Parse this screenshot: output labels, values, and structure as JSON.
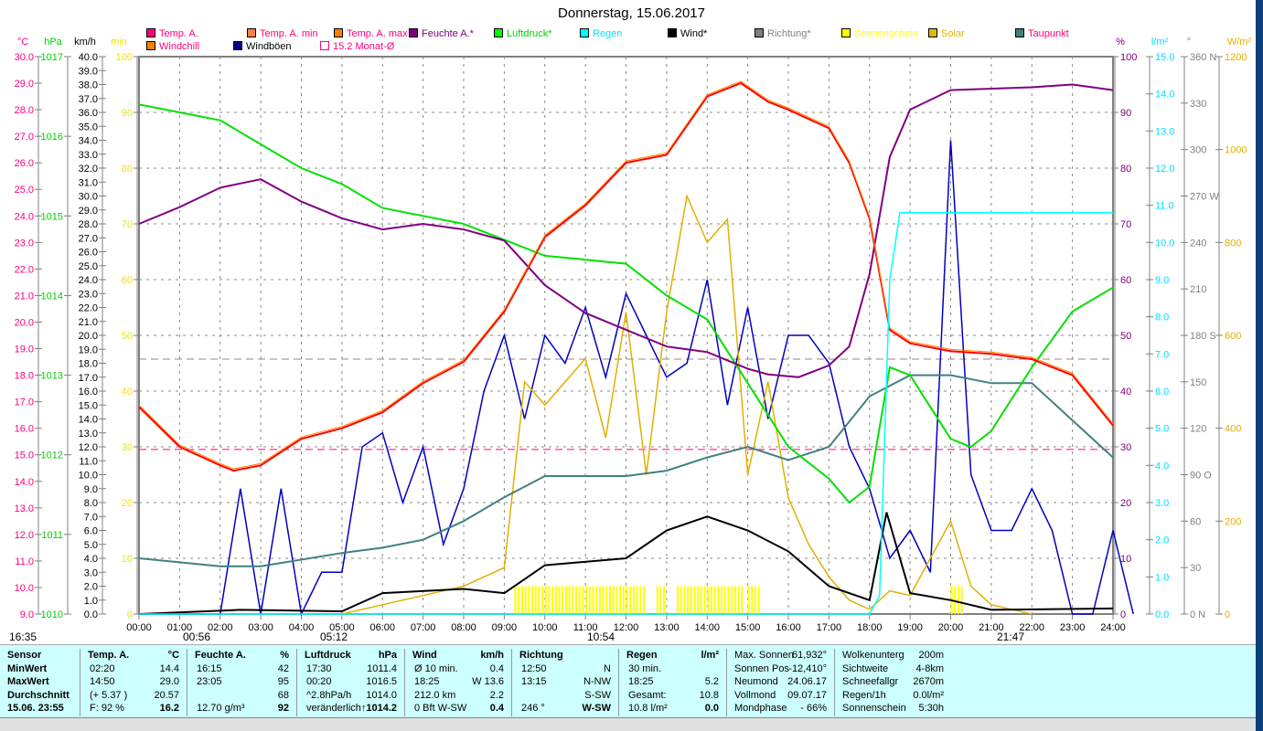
{
  "title": "Donnerstag, 15.06.2017",
  "legend": [
    {
      "label": "Temp. A.",
      "color": "#ff0080",
      "text": "#ff0080"
    },
    {
      "label": "Temp. A. min",
      "color": "#ff8040",
      "text": "#ff0080"
    },
    {
      "label": "Temp. A. max",
      "color": "#ff8000",
      "text": "#ff0080"
    },
    {
      "label": "Feuchte A.*",
      "color": "#800080",
      "text": "#800080"
    },
    {
      "label": "Luftdruck*",
      "color": "#00ff00",
      "text": "#00d000"
    },
    {
      "label": "Regen",
      "color": "#00ffff",
      "text": "#00e0ff"
    },
    {
      "label": "Wind*",
      "color": "#000000",
      "text": "#000000"
    },
    {
      "label": "Richtung*",
      "color": "#808080",
      "text": "#808080"
    },
    {
      "label": "Sonnenschein",
      "color": "#ffff00",
      "text": "#ffff00"
    },
    {
      "label": "Solar",
      "color": "#e0b800",
      "text": "#e0b800"
    },
    {
      "label": "Taupunkt",
      "color": "#408080",
      "text": "#ff0080"
    },
    {
      "label": "Windchill",
      "color": "#ff8000",
      "text": "#ff0080"
    },
    {
      "label": "Windböen",
      "color": "#000090",
      "text": "#000000"
    },
    {
      "label": "15.2 Monat-Ø",
      "color": "#ff0080",
      "text": "#ff0080"
    }
  ],
  "units": {
    "temp": "°C",
    "press": "hPa",
    "wind": "km/h",
    "sun": "min",
    "hum": "%",
    "rain": "l/m²",
    "dir": "°",
    "solar": "W/m²"
  },
  "sun_markers": {
    "moonset": "16:35",
    "moonrise": "00:56",
    "sunrise": "05:12",
    "noon": "10:54",
    "sunset": "21:47"
  },
  "chart_data": {
    "type": "line",
    "title": "Donnerstag, 15.06.2017",
    "x_range_hours": [
      0,
      24
    ],
    "x_ticks": [
      "00:00",
      "01:00",
      "02:00",
      "03:00",
      "04:00",
      "05:00",
      "06:00",
      "07:00",
      "08:00",
      "09:00",
      "10:00",
      "11:00",
      "12:00",
      "13:00",
      "14:00",
      "15:00",
      "16:00",
      "17:00",
      "18:00",
      "19:00",
      "20:00",
      "21:00",
      "22:00",
      "23:00",
      "24:00"
    ],
    "axes": {
      "temp": [
        9,
        30
      ],
      "press": [
        1010,
        1017
      ],
      "wind": [
        0,
        40
      ],
      "sun": [
        0,
        100
      ],
      "hum": [
        0,
        100
      ],
      "rain": [
        0,
        15
      ],
      "dir": [
        0,
        360
      ],
      "solar": [
        0,
        1200
      ]
    },
    "dir_labels": {
      "0": "N",
      "90": "O",
      "180": "S",
      "270": "W",
      "360": "N"
    },
    "month_avg_temp": 15.2,
    "series": [
      {
        "name": "Temp. A.",
        "axis": "temp",
        "color": "#ff0000",
        "points": [
          [
            0,
            16.8
          ],
          [
            1,
            15.3
          ],
          [
            2,
            14.6
          ],
          [
            2.33,
            14.4
          ],
          [
            3,
            14.6
          ],
          [
            4,
            15.6
          ],
          [
            5,
            16
          ],
          [
            6,
            16.6
          ],
          [
            7,
            17.7
          ],
          [
            8,
            18.5
          ],
          [
            9,
            20.4
          ],
          [
            10,
            23.2
          ],
          [
            11,
            24.4
          ],
          [
            12,
            26
          ],
          [
            13,
            26.3
          ],
          [
            14,
            28.5
          ],
          [
            14.83,
            29
          ],
          [
            15.5,
            28.3
          ],
          [
            16,
            28
          ],
          [
            17,
            27.3
          ],
          [
            17.5,
            26
          ],
          [
            18,
            23.9
          ],
          [
            18.5,
            19.7
          ],
          [
            19,
            19.2
          ],
          [
            20,
            18.9
          ],
          [
            21,
            18.8
          ],
          [
            22,
            18.6
          ],
          [
            23,
            18
          ],
          [
            24,
            16.1
          ]
        ]
      },
      {
        "name": "Feuchte A.*",
        "axis": "hum",
        "color": "#800080",
        "points": [
          [
            0,
            70
          ],
          [
            1,
            73
          ],
          [
            2,
            76.5
          ],
          [
            3,
            78
          ],
          [
            4,
            74
          ],
          [
            5,
            71
          ],
          [
            6,
            69
          ],
          [
            7,
            70
          ],
          [
            8,
            69
          ],
          [
            9,
            67
          ],
          [
            10,
            59
          ],
          [
            11,
            54
          ],
          [
            12,
            51
          ],
          [
            13,
            48
          ],
          [
            14,
            47
          ],
          [
            15,
            44
          ],
          [
            15.5,
            43
          ],
          [
            16.25,
            42.5
          ],
          [
            17,
            44.6
          ],
          [
            17.5,
            48
          ],
          [
            18,
            61
          ],
          [
            18.5,
            82
          ],
          [
            19,
            90.5
          ],
          [
            20,
            94
          ],
          [
            22,
            94.5
          ],
          [
            23,
            95
          ],
          [
            24,
            94
          ]
        ]
      },
      {
        "name": "Luftdruck*",
        "axis": "press",
        "color": "#00e000",
        "points": [
          [
            0,
            1016.4
          ],
          [
            1,
            1016.3
          ],
          [
            2,
            1016.2
          ],
          [
            3,
            1015.9
          ],
          [
            4,
            1015.6
          ],
          [
            5,
            1015.4
          ],
          [
            6,
            1015.1
          ],
          [
            7,
            1015
          ],
          [
            8,
            1014.9
          ],
          [
            9,
            1014.7
          ],
          [
            10,
            1014.5
          ],
          [
            11,
            1014.45
          ],
          [
            12,
            1014.4
          ],
          [
            13,
            1014
          ],
          [
            14,
            1013.7
          ],
          [
            15,
            1012.9
          ],
          [
            16,
            1012.1
          ],
          [
            17,
            1011.7
          ],
          [
            17.5,
            1011.4
          ],
          [
            18,
            1011.6
          ],
          [
            18.5,
            1013.1
          ],
          [
            19,
            1013
          ],
          [
            20,
            1012.2
          ],
          [
            20.5,
            1012.1
          ],
          [
            21,
            1012.3
          ],
          [
            22,
            1013.1
          ],
          [
            23,
            1013.8
          ],
          [
            24,
            1014.1
          ]
        ]
      },
      {
        "name": "Taupunkt",
        "axis": "temp",
        "color": "#408080",
        "points": [
          [
            0,
            11.1
          ],
          [
            2,
            10.8
          ],
          [
            3,
            10.8
          ],
          [
            5,
            11.3
          ],
          [
            6,
            11.5
          ],
          [
            7,
            11.8
          ],
          [
            8,
            12.5
          ],
          [
            9,
            13.4
          ],
          [
            10,
            14.2
          ],
          [
            11,
            14.2
          ],
          [
            12,
            14.2
          ],
          [
            13,
            14.4
          ],
          [
            14,
            14.9
          ],
          [
            15,
            15.3
          ],
          [
            16,
            14.8
          ],
          [
            17,
            15.3
          ],
          [
            18,
            17.2
          ],
          [
            19,
            18
          ],
          [
            20,
            18
          ],
          [
            21,
            17.7
          ],
          [
            22,
            17.7
          ],
          [
            23,
            16.3
          ],
          [
            24,
            14.9
          ]
        ]
      },
      {
        "name": "Windböen",
        "axis": "wind",
        "color": "#0000c0",
        "step": 0.5,
        "values": [
          0,
          0,
          0,
          0,
          0,
          9,
          0,
          9,
          0,
          3,
          3,
          12,
          13,
          8,
          12,
          5,
          9,
          16,
          20,
          14,
          20,
          18,
          22,
          17,
          23,
          20,
          17,
          18,
          24,
          15,
          22,
          14,
          20,
          20,
          18,
          12,
          9,
          4,
          6,
          3,
          34,
          10,
          6,
          6,
          9,
          6,
          0,
          0,
          6,
          0
        ]
      },
      {
        "name": "Wind*",
        "axis": "wind",
        "color": "#000000",
        "points": [
          [
            0,
            0
          ],
          [
            2.5,
            0.3
          ],
          [
            5,
            0.2
          ],
          [
            6,
            1.5
          ],
          [
            8,
            1.8
          ],
          [
            9,
            1.5
          ],
          [
            10,
            3.5
          ],
          [
            12,
            4
          ],
          [
            13,
            6
          ],
          [
            14,
            7
          ],
          [
            15,
            6
          ],
          [
            16,
            4.5
          ],
          [
            17,
            2
          ],
          [
            18,
            1
          ],
          [
            18.42,
            7.3
          ],
          [
            19,
            1.5
          ],
          [
            20,
            1
          ],
          [
            21,
            0.3
          ],
          [
            24,
            0.4
          ]
        ]
      },
      {
        "name": "Solar",
        "axis": "solar",
        "color": "#e0b000",
        "points": [
          [
            5,
            0
          ],
          [
            6,
            20
          ],
          [
            7,
            40
          ],
          [
            8,
            60
          ],
          [
            9,
            100
          ],
          [
            9.5,
            500
          ],
          [
            10,
            450
          ],
          [
            11,
            550
          ],
          [
            11.5,
            380
          ],
          [
            12,
            650
          ],
          [
            12.5,
            300
          ],
          [
            13,
            650
          ],
          [
            13.5,
            900
          ],
          [
            14,
            800
          ],
          [
            14.5,
            850
          ],
          [
            15,
            300
          ],
          [
            15.5,
            500
          ],
          [
            16,
            250
          ],
          [
            16.5,
            150
          ],
          [
            17,
            80
          ],
          [
            17.5,
            30
          ],
          [
            18,
            10
          ],
          [
            18.5,
            50
          ],
          [
            19,
            40
          ],
          [
            20,
            200
          ],
          [
            20.5,
            60
          ],
          [
            21,
            20
          ],
          [
            22,
            0
          ]
        ]
      },
      {
        "name": "Regen",
        "axis": "rain",
        "color": "#00ffff",
        "points": [
          [
            0,
            0
          ],
          [
            18,
            0
          ],
          [
            18.25,
            0.5
          ],
          [
            18.5,
            9
          ],
          [
            18.75,
            10.8
          ],
          [
            24,
            10.8
          ]
        ]
      }
    ],
    "sunshine_intervals": [
      [
        9.25,
        12.5
      ],
      [
        12.75,
        13.0
      ],
      [
        13.25,
        14.9
      ],
      [
        15.0,
        15.3
      ],
      [
        20.0,
        20.3
      ]
    ]
  },
  "table": {
    "headers": [
      [
        "Sensor"
      ],
      [
        "Temp. A.",
        "°C"
      ],
      [
        "Feuchte A.",
        "%"
      ],
      [
        "Luftdruck",
        "hPa"
      ],
      [
        "Wind",
        "km/h"
      ],
      [
        "Richtung",
        ""
      ],
      [
        "Regen",
        "l/m²"
      ]
    ],
    "rows": [
      [
        "MinWert",
        "02:20",
        "14.4",
        "16:15",
        "42",
        "17:30",
        "1011.4",
        "Ø 10 min.",
        "0.4",
        "12:50",
        "N",
        "30 min.",
        ""
      ],
      [
        "MaxWert",
        "14:50",
        "29.0",
        "23:05",
        "95",
        "00:20",
        "1016.5",
        "18:25",
        "W 13.6",
        "13:15",
        "N-NW",
        "18:25",
        "5.2"
      ],
      [
        "Durchschnitt",
        "(+ 5.37 )",
        "20.57",
        "",
        "68",
        "^2.8hPa/h",
        "1014.0",
        "212.0 km",
        "2.2",
        "",
        "S-SW",
        "Gesamt:",
        "10.8"
      ],
      [
        "15.06. 23:55",
        "F: 92 %",
        "16.2",
        "12.70 g/m³",
        "92",
        "veränderlich↑",
        "1014.2",
        "0 Bft W-SW",
        "0.4",
        "246 °",
        "W-SW",
        "10.8 l/m²",
        "0.0"
      ]
    ],
    "astro": [
      [
        "Max. Sonnen",
        "61,932°"
      ],
      [
        "Sonnen Pos",
        "-12,410°"
      ],
      [
        "Neumond",
        "24.06.17"
      ],
      [
        "Vollmond",
        "09.07.17"
      ],
      [
        "Mondphase",
        "- 66%"
      ]
    ],
    "misc": [
      [
        "Wolkenunterg",
        "200m"
      ],
      [
        "Sichtweite",
        "4-8km"
      ],
      [
        "Schneefallgr",
        "2670m"
      ],
      [
        "Regen/1h",
        "0.0l/m²"
      ],
      [
        "Sonnenschein",
        "5:30h"
      ]
    ]
  }
}
